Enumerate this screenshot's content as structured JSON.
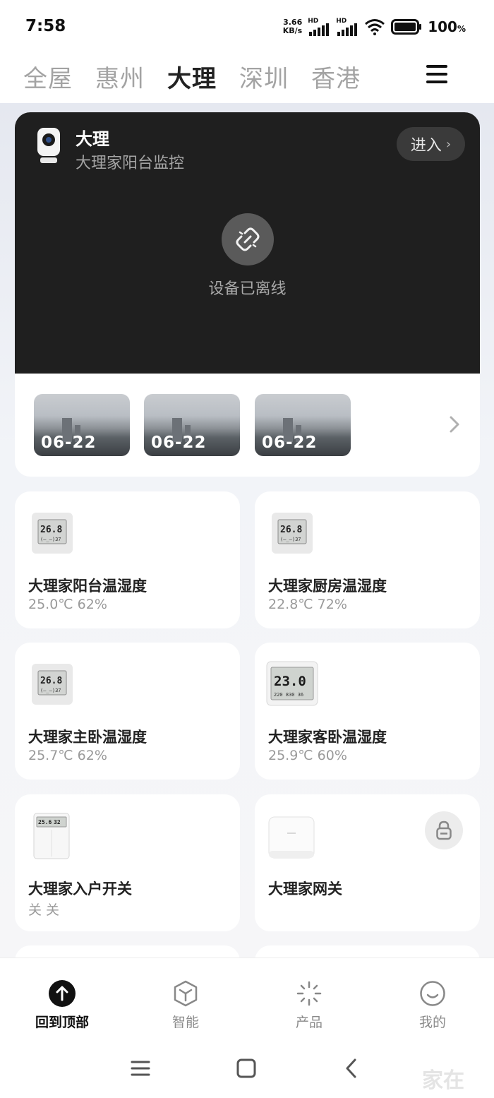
{
  "status_bar": {
    "time": "7:58",
    "net_speed_value": "3.66",
    "net_speed_unit": "KB/s",
    "sim1_tag": "HD",
    "sim2_tag": "HD",
    "battery": "100",
    "battery_unit": "%"
  },
  "tabs": [
    {
      "label": "全屋",
      "active": false
    },
    {
      "label": "惠州",
      "active": false
    },
    {
      "label": "大理",
      "active": true
    },
    {
      "label": "深圳",
      "active": false
    },
    {
      "label": "香港",
      "active": false
    }
  ],
  "camera": {
    "title": "大理",
    "subtitle": "大理家阳台监控",
    "enter_label": "进入",
    "offline_text": "设备已离线",
    "clips": [
      {
        "date": "06-22"
      },
      {
        "date": "06-22"
      },
      {
        "date": "06-22"
      }
    ]
  },
  "devices": [
    {
      "name": "大理家阳台温湿度",
      "status": "25.0℃ 62%",
      "icon": "thermo-hygrometer-icon"
    },
    {
      "name": "大理家厨房温湿度",
      "status": "22.8℃ 72%",
      "icon": "thermo-hygrometer-icon"
    },
    {
      "name": "大理家主卧温湿度",
      "status": "25.7℃ 62%",
      "icon": "thermo-hygrometer-icon"
    },
    {
      "name": "大理家客卧温湿度",
      "status": "25.9℃ 60%",
      "icon": "thermo-hygrometer-large-icon"
    },
    {
      "name": "大理家入户开关",
      "status": "关 关",
      "icon": "wall-switch-icon"
    },
    {
      "name": "大理家网关",
      "status": "",
      "icon": "gateway-icon"
    }
  ],
  "icon_text": {
    "thermo_main": "26.8",
    "thermo_sub": "(–_–)37",
    "thermo_large_main": "23.0",
    "thermo_large_sub": "220 830 36",
    "switch_left": "25.6",
    "switch_right": "32"
  },
  "bottom_nav": [
    {
      "label": "回到顶部",
      "icon": "arrow-up-icon",
      "active": true
    },
    {
      "label": "智能",
      "icon": "cube-icon",
      "active": false
    },
    {
      "label": "产品",
      "icon": "sparkle-icon",
      "active": false
    },
    {
      "label": "我的",
      "icon": "smiley-icon",
      "active": false
    }
  ],
  "watermark": "家在",
  "colors": {
    "camera_bg": "#1f1f1f",
    "page_bg": "#f2f4f8",
    "card_bg": "#ffffff",
    "active_tab": "#222222",
    "inactive_tab": "#a3a3a3"
  }
}
